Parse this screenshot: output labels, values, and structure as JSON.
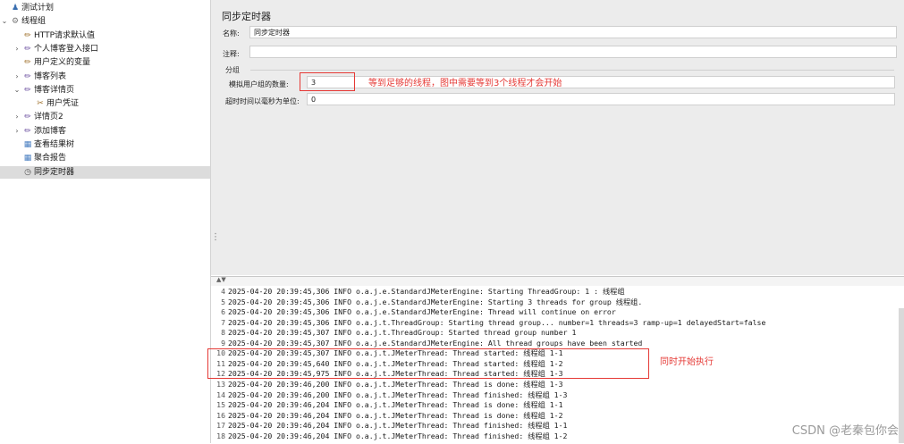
{
  "tree": {
    "items": [
      {
        "toggle": "",
        "icon": "♟",
        "iconClass": "plan",
        "label": "测试计划",
        "selected": false
      },
      {
        "toggle": "⌄",
        "icon": "⚙",
        "iconClass": "tg",
        "label": "线程组",
        "selected": false
      },
      {
        "toggle": "",
        "icon": "✏",
        "iconClass": "cfg",
        "label": "HTTP请求默认值",
        "selected": false
      },
      {
        "toggle": "›",
        "icon": "✏",
        "iconClass": "sam",
        "label": "个人博客登入接口",
        "selected": false
      },
      {
        "toggle": "",
        "icon": "✏",
        "iconClass": "cfg",
        "label": "用户定义的变量",
        "selected": false
      },
      {
        "toggle": "›",
        "icon": "✏",
        "iconClass": "sam",
        "label": "博客列表",
        "selected": false
      },
      {
        "toggle": "⌄",
        "icon": "✏",
        "iconClass": "sam",
        "label": "博客详情页",
        "selected": false
      },
      {
        "toggle": "",
        "icon": "✂",
        "iconClass": "cfg",
        "label": "用户凭证",
        "selected": false
      },
      {
        "toggle": "›",
        "icon": "✏",
        "iconClass": "sam",
        "label": "详情页2",
        "selected": false
      },
      {
        "toggle": "›",
        "icon": "✏",
        "iconClass": "sam",
        "label": "添加博客",
        "selected": false
      },
      {
        "toggle": "",
        "icon": "▦",
        "iconClass": "lst",
        "label": "查看结果树",
        "selected": false
      },
      {
        "toggle": "",
        "icon": "▦",
        "iconClass": "lst",
        "label": "聚合报告",
        "selected": false
      },
      {
        "toggle": "",
        "icon": "◷",
        "iconClass": "tmr",
        "label": "同步定时器",
        "selected": true
      }
    ]
  },
  "panel": {
    "title": "同步定时器",
    "name_label": "名称:",
    "name_value": "同步定时器",
    "comment_label": "注释:",
    "comment_value": "",
    "group_label": "分组",
    "users_label": "模拟用户组的数量:",
    "users_value": "3",
    "timeout_label": "超时时间以毫秒为单位:",
    "timeout_value": "0",
    "annotation_1": "等到足够的线程，图中需要等到3个线程才会开始"
  },
  "console": {
    "lines": [
      {
        "n": "4",
        "text": "2025-04-20 20:39:45,306 INFO o.a.j.e.StandardJMeterEngine: Starting ThreadGroup: 1 : 线程组"
      },
      {
        "n": "5",
        "text": "2025-04-20 20:39:45,306 INFO o.a.j.e.StandardJMeterEngine: Starting 3 threads for group 线程组."
      },
      {
        "n": "6",
        "text": "2025-04-20 20:39:45,306 INFO o.a.j.e.StandardJMeterEngine: Thread will continue on error"
      },
      {
        "n": "7",
        "text": "2025-04-20 20:39:45,306 INFO o.a.j.t.ThreadGroup: Starting thread group... number=1 threads=3 ramp-up=1 delayedStart=false"
      },
      {
        "n": "8",
        "text": "2025-04-20 20:39:45,307 INFO o.a.j.t.ThreadGroup: Started thread group number 1"
      },
      {
        "n": "9",
        "text": "2025-04-20 20:39:45,307 INFO o.a.j.e.StandardJMeterEngine: All thread groups have been started"
      },
      {
        "n": "10",
        "text": "2025-04-20 20:39:45,307 INFO o.a.j.t.JMeterThread: Thread started: 线程组 1-1"
      },
      {
        "n": "11",
        "text": "2025-04-20 20:39:45,640 INFO o.a.j.t.JMeterThread: Thread started: 线程组 1-2"
      },
      {
        "n": "12",
        "text": "2025-04-20 20:39:45,975 INFO o.a.j.t.JMeterThread: Thread started: 线程组 1-3"
      },
      {
        "n": "13",
        "text": "2025-04-20 20:39:46,200 INFO o.a.j.t.JMeterThread: Thread is done: 线程组 1-3"
      },
      {
        "n": "14",
        "text": "2025-04-20 20:39:46,200 INFO o.a.j.t.JMeterThread: Thread finished: 线程组 1-3"
      },
      {
        "n": "15",
        "text": "2025-04-20 20:39:46,204 INFO o.a.j.t.JMeterThread: Thread is done: 线程组 1-1"
      },
      {
        "n": "16",
        "text": "2025-04-20 20:39:46,204 INFO o.a.j.t.JMeterThread: Thread is done: 线程组 1-2"
      },
      {
        "n": "17",
        "text": "2025-04-20 20:39:46,204 INFO o.a.j.t.JMeterThread: Thread finished: 线程组 1-1"
      },
      {
        "n": "18",
        "text": "2025-04-20 20:39:46,204 INFO o.a.j.t.JMeterThread: Thread finished: 线程组 1-2"
      }
    ],
    "annotation_2": "同时开始执行"
  },
  "watermark": "CSDN @老秦包你会"
}
